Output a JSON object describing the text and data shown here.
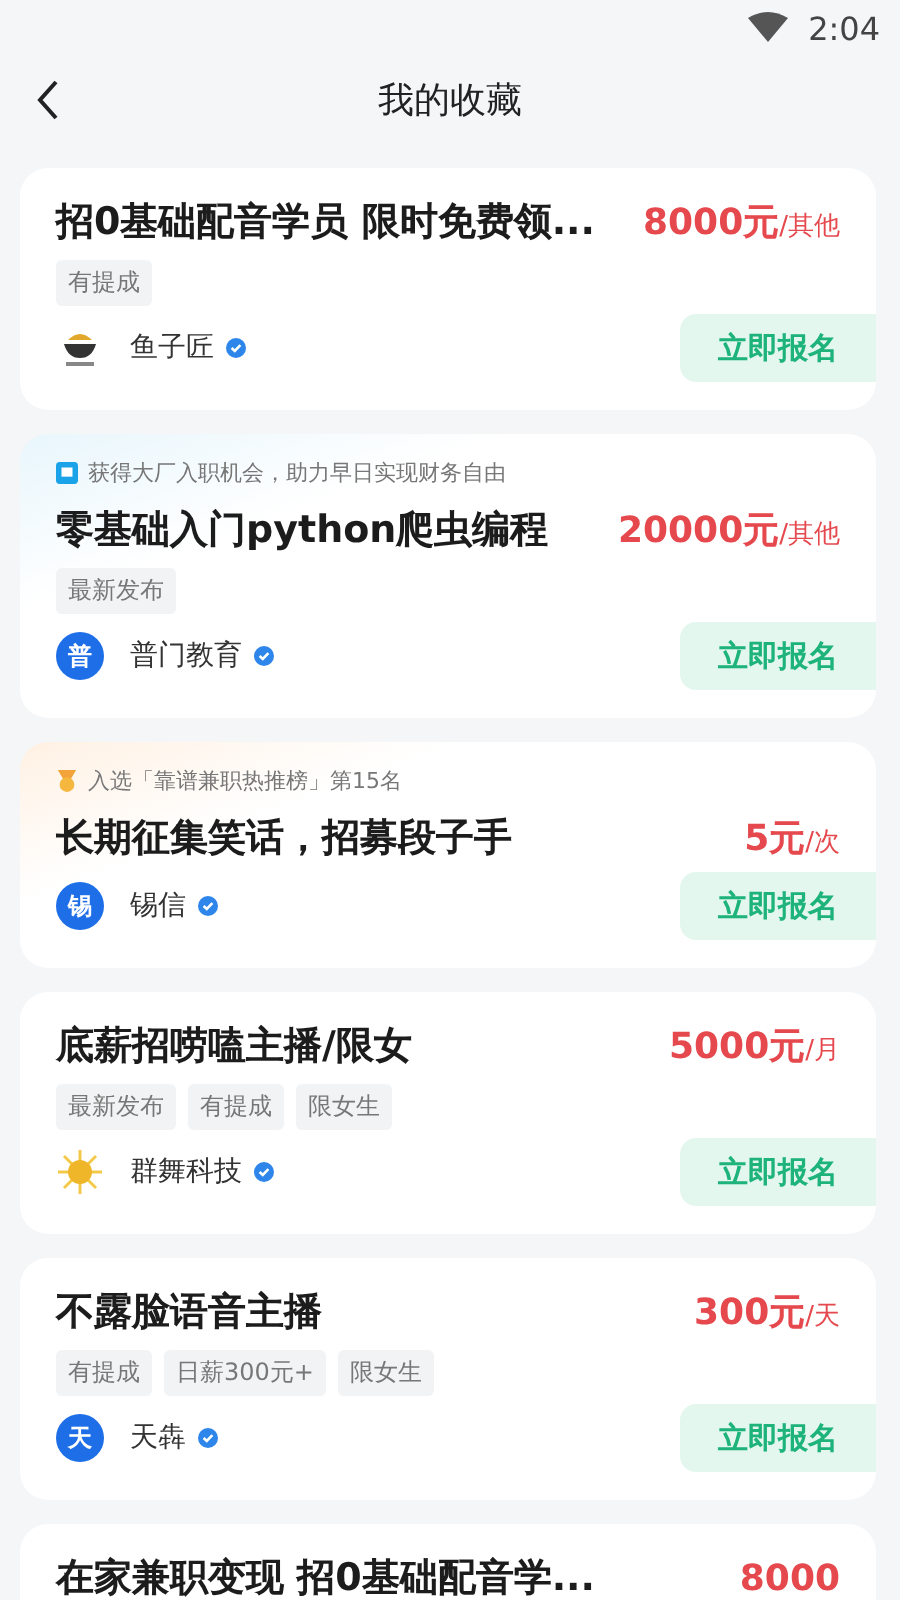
{
  "status_bar": {
    "time": "2:04"
  },
  "header": {
    "title": "我的收藏"
  },
  "cards": [
    {
      "title": "招0基础配音学员 限时免费领...",
      "price": "8000元",
      "unit": "/其他",
      "tags": [
        "有提成"
      ],
      "company": {
        "name": "鱼子匠",
        "verified": true,
        "avatar": {
          "kind": "logo"
        }
      },
      "button": "立即报名"
    },
    {
      "banner": {
        "kind": "info",
        "text": "获得大厂入职机会，助力早日实现财务自由"
      },
      "title": "零基础入门python爬虫编程",
      "price": "20000元",
      "unit": "/其他",
      "tags": [
        "最新发布"
      ],
      "company": {
        "name": "普门教育",
        "verified": true,
        "avatar": {
          "kind": "letter",
          "text": "普"
        }
      },
      "button": "立即报名"
    },
    {
      "banner": {
        "kind": "rank",
        "text": "入选「靠谱兼职热推榜」第15名"
      },
      "title": "长期征集笑话，招募段子手",
      "price": "5元",
      "unit": "/次",
      "company": {
        "name": "锡信",
        "verified": true,
        "avatar": {
          "kind": "letter",
          "text": "锡"
        }
      },
      "button": "立即报名"
    },
    {
      "title": "底薪招唠嗑主播/限女",
      "price": "5000元",
      "unit": "/月",
      "tags": [
        "最新发布",
        "有提成",
        "限女生"
      ],
      "company": {
        "name": "群舞科技",
        "verified": true,
        "avatar": {
          "kind": "sun"
        }
      },
      "button": "立即报名"
    },
    {
      "title": "不露脸语音主播",
      "price": "300元",
      "unit": "/天",
      "tags": [
        "有提成",
        "日薪300元+",
        "限女生"
      ],
      "company": {
        "name": "天犇",
        "verified": true,
        "avatar": {
          "kind": "letter",
          "text": "天"
        }
      },
      "button": "立即报名"
    },
    {
      "title": "在家兼职变现 招0基础配音学...",
      "price": "8000"
    }
  ]
}
